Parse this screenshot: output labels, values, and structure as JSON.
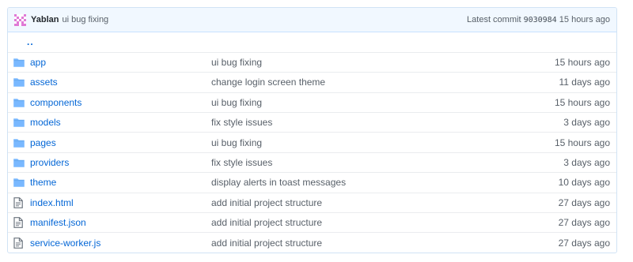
{
  "commit": {
    "author": "Yablan",
    "message": "ui bug fixing",
    "latest_label": "Latest commit",
    "sha": "9030984",
    "age": "15 hours ago"
  },
  "up_tree": "..",
  "entries": [
    {
      "name": "app",
      "type": "folder",
      "message": "ui bug fixing",
      "age": "15 hours ago"
    },
    {
      "name": "assets",
      "type": "folder",
      "message": "change login screen theme",
      "age": "11 days ago"
    },
    {
      "name": "components",
      "type": "folder",
      "message": "ui bug fixing",
      "age": "15 hours ago"
    },
    {
      "name": "models",
      "type": "folder",
      "message": "fix style issues",
      "age": "3 days ago"
    },
    {
      "name": "pages",
      "type": "folder",
      "message": "ui bug fixing",
      "age": "15 hours ago"
    },
    {
      "name": "providers",
      "type": "folder",
      "message": "fix style issues",
      "age": "3 days ago"
    },
    {
      "name": "theme",
      "type": "folder",
      "message": "display alerts in toast messages",
      "age": "10 days ago"
    },
    {
      "name": "index.html",
      "type": "file",
      "message": "add initial project structure",
      "age": "27 days ago"
    },
    {
      "name": "manifest.json",
      "type": "file",
      "message": "add initial project structure",
      "age": "27 days ago"
    },
    {
      "name": "service-worker.js",
      "type": "file",
      "message": "add initial project structure",
      "age": "27 days ago"
    }
  ],
  "colors": {
    "folder_icon": "#79b8ff",
    "file_icon": "#6a737d",
    "link": "#0366d6",
    "header_bg": "#f1f8ff"
  }
}
